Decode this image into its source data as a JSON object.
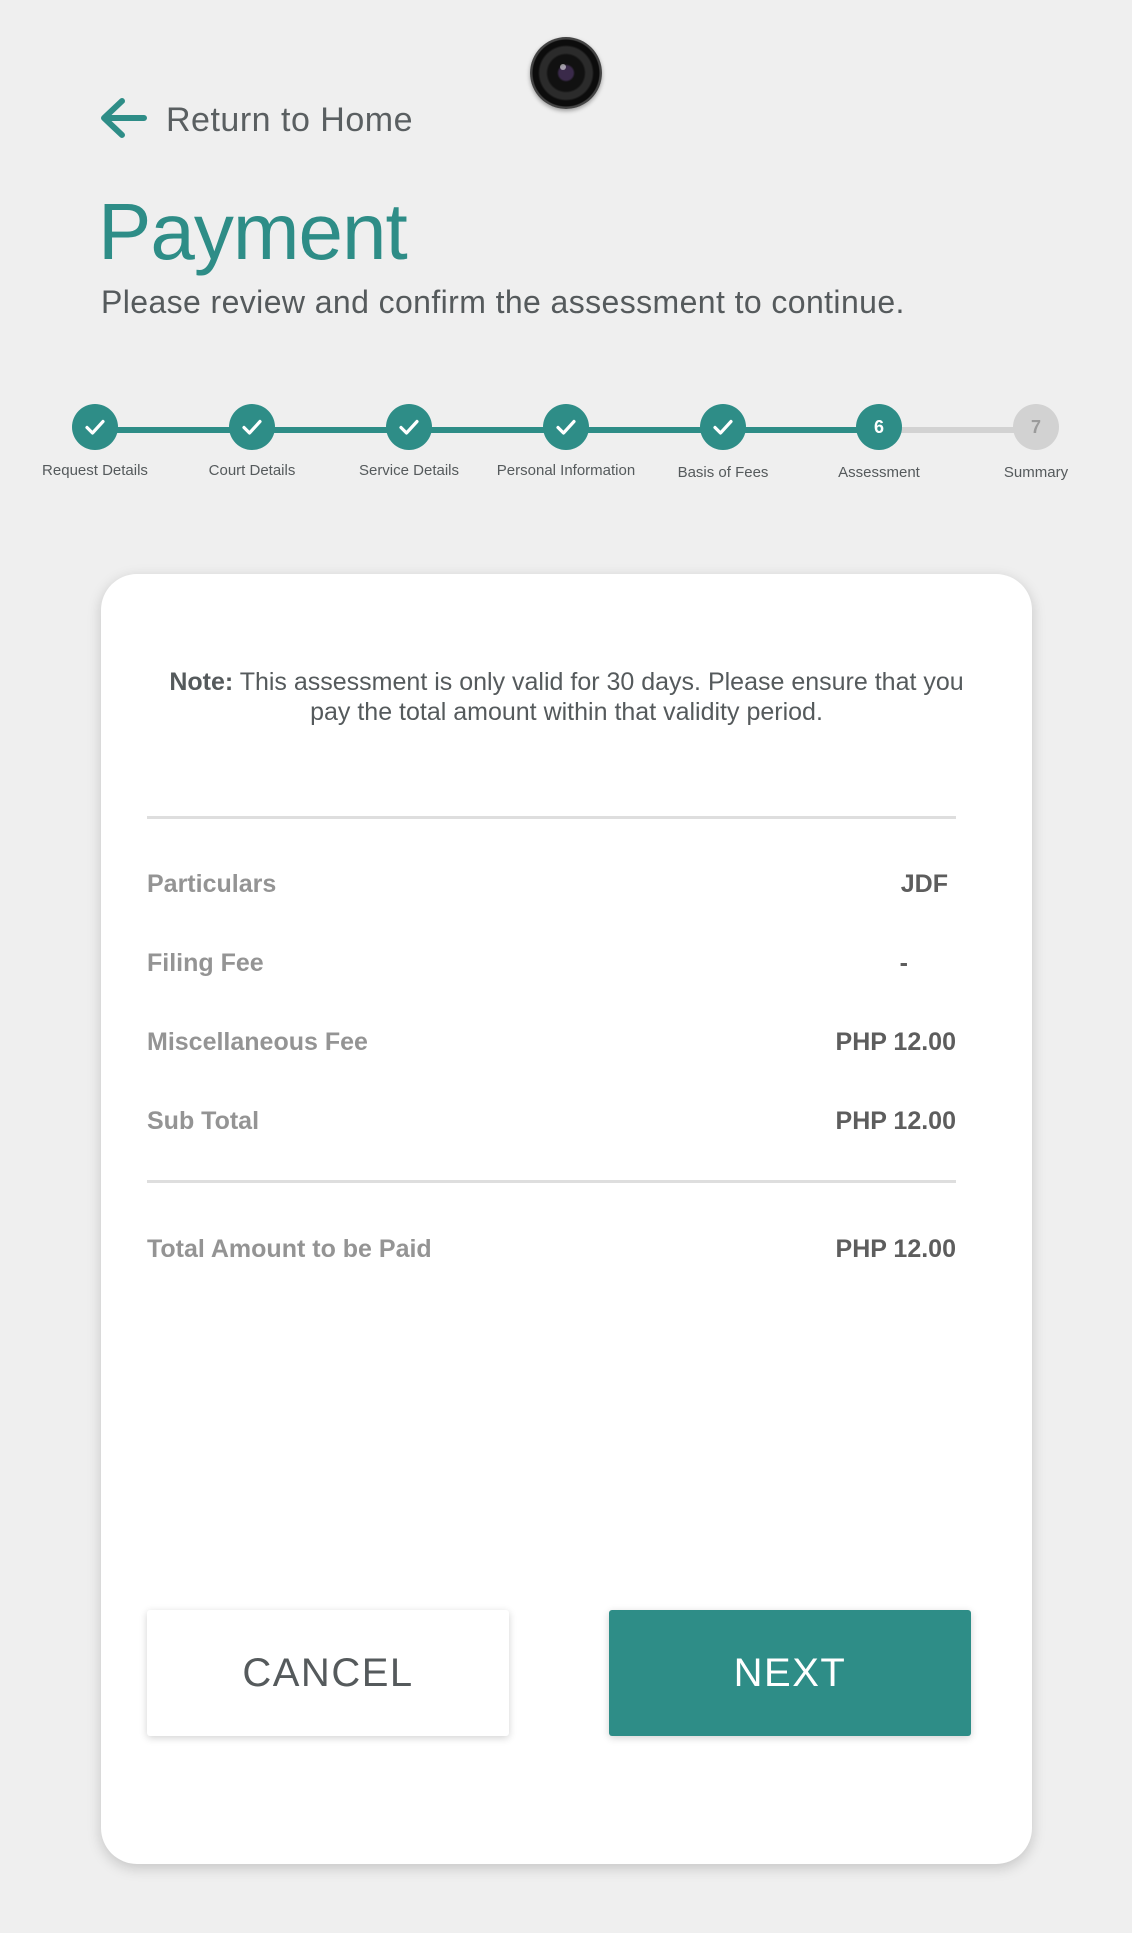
{
  "header": {
    "back_label": "Return to Home",
    "title": "Payment",
    "subtitle": "Please review and confirm the assessment to continue."
  },
  "stepper": {
    "current_step": 6,
    "steps": [
      {
        "label": "Request Details",
        "status": "done"
      },
      {
        "label": "Court Details",
        "status": "done"
      },
      {
        "label": "Service Details",
        "status": "done"
      },
      {
        "label": "Personal Information",
        "status": "done"
      },
      {
        "label": "Basis of Fees",
        "status": "done"
      },
      {
        "label": "Assessment",
        "status": "current",
        "number": "6"
      },
      {
        "label": "Summary",
        "status": "pending",
        "number": "7"
      }
    ]
  },
  "assessment": {
    "note_label": "Note:",
    "note_text": " This assessment is only valid for 30 days. Please ensure that you pay the total amount within that validity period.",
    "rows": [
      {
        "label": "Particulars",
        "value": "JDF"
      },
      {
        "label": "Filing Fee",
        "value": "-"
      },
      {
        "label": "Miscellaneous Fee",
        "value": "PHP 12.00"
      },
      {
        "label": "Sub Total",
        "value": "PHP 12.00"
      }
    ],
    "total": {
      "label": "Total Amount to be Paid",
      "value": "PHP 12.00"
    }
  },
  "actions": {
    "cancel_label": "CANCEL",
    "next_label": "NEXT"
  },
  "colors": {
    "accent": "#2e8d87",
    "background": "#efefef",
    "pending": "#d2d2d2"
  },
  "icons": {
    "back": "arrow-left-icon",
    "step_done": "check-icon",
    "camera": "camera-icon"
  }
}
